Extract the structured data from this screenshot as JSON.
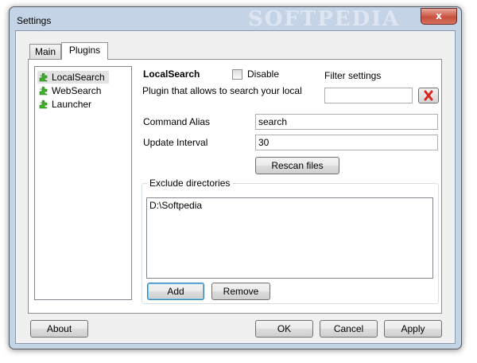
{
  "window": {
    "title": "Settings",
    "watermark": "SOFTPEDIA",
    "close_glyph": "x"
  },
  "tabs": [
    {
      "label": "Main"
    },
    {
      "label": "Plugins",
      "active": true
    }
  ],
  "plugins_tree": [
    {
      "label": "LocalSearch",
      "icon": "puzzle-piece-icon",
      "selected": true
    },
    {
      "label": "WebSearch",
      "icon": "puzzle-piece-icon"
    },
    {
      "label": "Launcher",
      "icon": "puzzle-piece-icon"
    }
  ],
  "plugin": {
    "name": "LocalSearch",
    "disable_label": "Disable",
    "disable_checked": false,
    "description": "Plugin that allows to search your local",
    "filter_label": "Filter settings",
    "filter_value": "",
    "clear_filter_icon": "red-x-icon",
    "command_alias_label": "Command Alias",
    "command_alias_value": "search",
    "update_interval_label": "Update Interval",
    "update_interval_value": "30",
    "rescan_label": "Rescan files",
    "exclude_title": "Exclude directories",
    "exclude_items": [
      "D:\\Softpedia"
    ],
    "add_label": "Add",
    "remove_label": "Remove"
  },
  "footer": {
    "about_label": "About",
    "ok_label": "OK",
    "cancel_label": "Cancel",
    "apply_label": "Apply"
  },
  "colors": {
    "frame": "#c4d3e6",
    "close_button": "#c7503c",
    "clear_icon": "#d8261c",
    "puzzle_icon": "#3fae2a"
  }
}
